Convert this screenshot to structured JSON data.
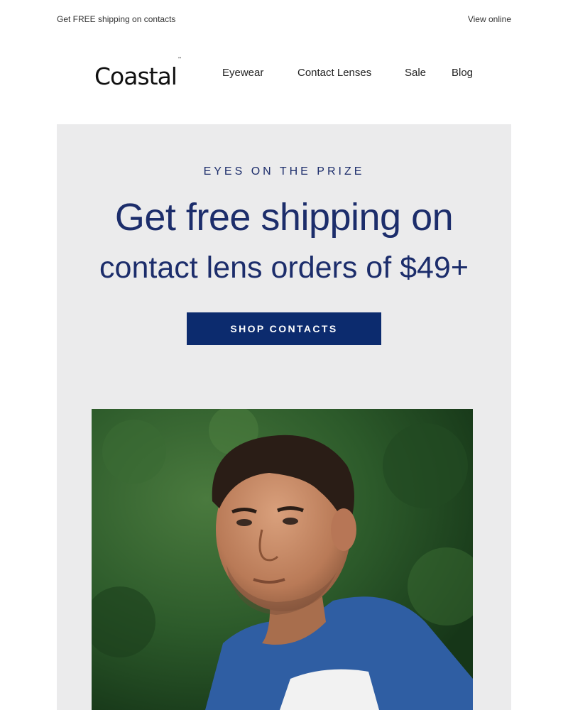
{
  "preheader": {
    "left_text": "Get FREE shipping on contacts",
    "right_link": "View online"
  },
  "header": {
    "logo_text": "Coastal",
    "logo_mark": "™",
    "nav": [
      {
        "label": "Eyewear"
      },
      {
        "label": "Contact Lenses"
      },
      {
        "label": "Sale"
      },
      {
        "label": "Blog"
      }
    ]
  },
  "hero": {
    "eyebrow": "EYES ON THE PRIZE",
    "headline_line1": "Get free shipping on",
    "headline_line2": "contact lens orders of $49+",
    "cta_label": "SHOP CONTACTS",
    "photo_alt": "man-in-blue-tshirt-outdoors",
    "colors": {
      "background": "#ebebec",
      "headline": "#1c2d6b",
      "button": "#0c2b6e"
    }
  }
}
